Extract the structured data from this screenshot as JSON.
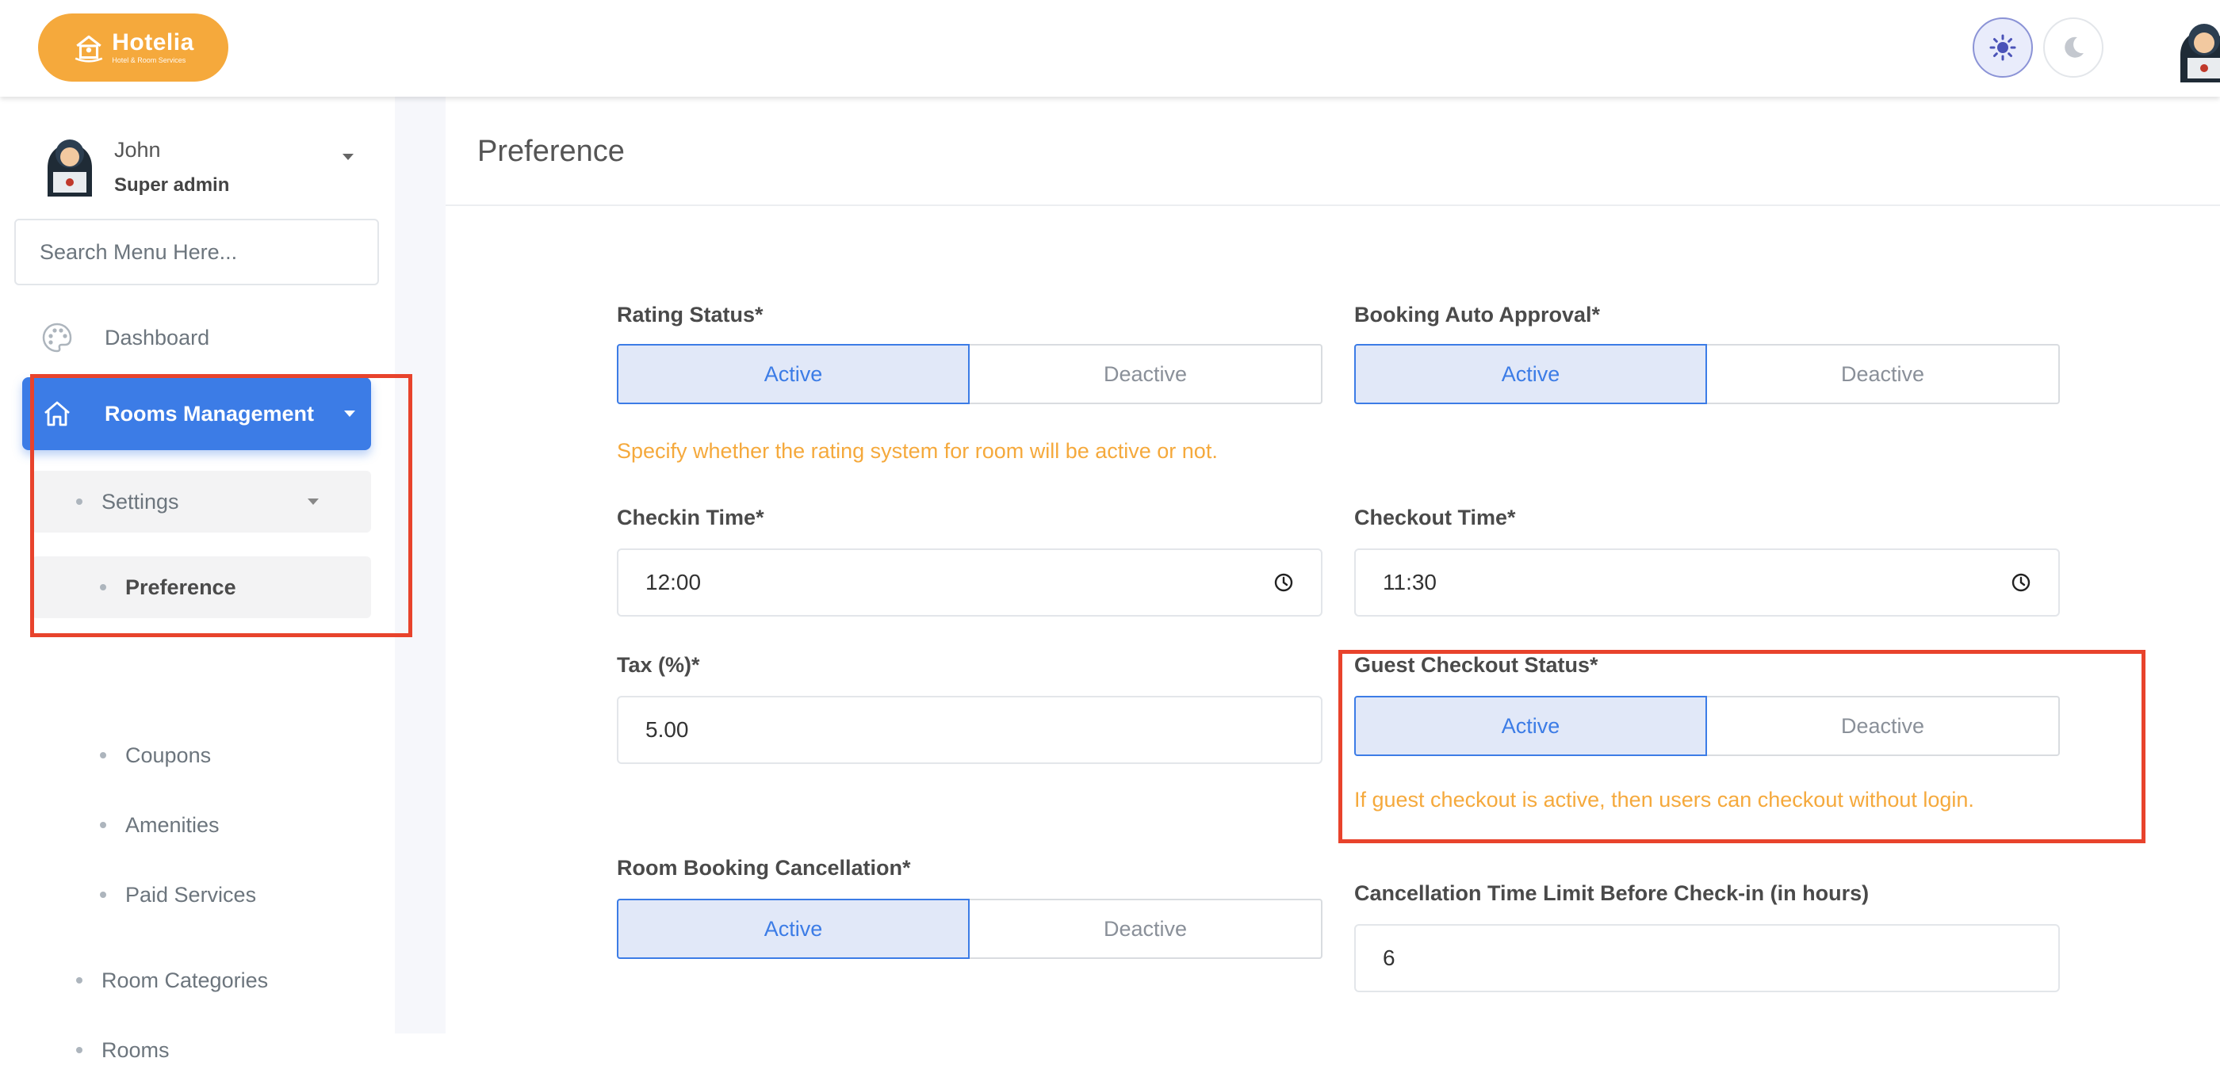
{
  "app": {
    "logo_name": "Hotelia",
    "logo_tagline": "Hotel & Room Services",
    "brand_color": "#f5a93c",
    "accent_color": "#3c7ce6",
    "highlight_color": "#e8432c"
  },
  "topbar": {
    "light_mode_icon": "sun-icon",
    "dark_mode_icon": "moon-icon"
  },
  "sidebar": {
    "user": {
      "name": "John",
      "role": "Super admin"
    },
    "search_placeholder": "Search Menu Here...",
    "items": [
      {
        "label": "Dashboard",
        "icon": "palette-icon"
      },
      {
        "label": "Rooms Management",
        "icon": "home-icon",
        "active": true
      }
    ],
    "sub_items": [
      {
        "label": "Settings"
      },
      {
        "label": "Preference",
        "active": true
      },
      {
        "label": "Coupons"
      },
      {
        "label": "Amenities"
      },
      {
        "label": "Paid Services"
      },
      {
        "label": "Room Categories"
      },
      {
        "label": "Rooms"
      }
    ]
  },
  "main": {
    "title": "Preference",
    "rating_status": {
      "label": "Rating Status*",
      "active": "Active",
      "deactive": "Deactive",
      "selected": "Active",
      "hint": "Specify whether the rating system for room will be active or not."
    },
    "booking_auto_approval": {
      "label": "Booking Auto Approval*",
      "active": "Active",
      "deactive": "Deactive",
      "selected": "Active"
    },
    "checkin_time": {
      "label": "Checkin Time*",
      "value": "12:00"
    },
    "checkout_time": {
      "label": "Checkout Time*",
      "value": "11:30"
    },
    "tax": {
      "label": "Tax (%)*",
      "value": "5.00"
    },
    "guest_checkout_status": {
      "label": "Guest Checkout Status*",
      "active": "Active",
      "deactive": "Deactive",
      "selected": "Active",
      "hint": "If guest checkout is active, then users can checkout without login."
    },
    "room_booking_cancellation": {
      "label": "Room Booking Cancellation*",
      "active": "Active",
      "deactive": "Deactive",
      "selected": "Active"
    },
    "cancellation_time_limit": {
      "label": "Cancellation Time Limit Before Check-in (in hours)",
      "value": "6"
    }
  }
}
